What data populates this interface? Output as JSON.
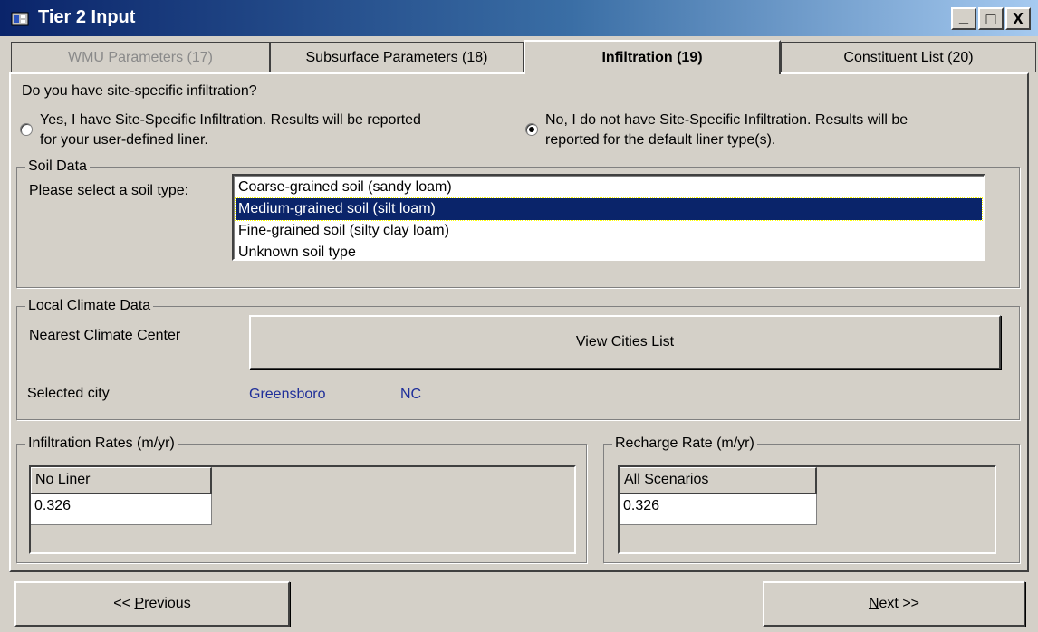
{
  "window": {
    "title": "Tier 2 Input",
    "minimize": "_",
    "maximize": "□",
    "close": "X"
  },
  "tabs": [
    {
      "label": "WMU Parameters (17)",
      "state": "disabled"
    },
    {
      "label": "Subsurface Parameters (18)",
      "state": "normal"
    },
    {
      "label": "Infiltration (19)",
      "state": "active"
    },
    {
      "label": "Constituent List (20)",
      "state": "normal"
    }
  ],
  "question": "Do you have site-specific infiltration?",
  "radios": {
    "yes": {
      "line1": "Yes, I have Site-Specific Infiltration.  Results will be reported",
      "line2": "for your user-defined liner.",
      "checked": false
    },
    "no": {
      "line1": "No, I do not have Site-Specific Infiltration.  Results will be",
      "line2": "reported for the default liner type(s).",
      "checked": true
    }
  },
  "soil": {
    "legend": "Soil Data",
    "prompt": "Please select a soil type:",
    "options": [
      "Coarse-grained soil (sandy loam)",
      "Medium-grained soil (silt loam)",
      "Fine-grained soil (silty clay loam)",
      "Unknown soil type"
    ],
    "selected_index": 1
  },
  "climate": {
    "legend": "Local Climate Data",
    "nearest_label": "Nearest Climate Center",
    "view_button": "View Cities List",
    "selected_label": "Selected city",
    "city": "Greensboro",
    "state": "NC",
    "value_color": "#1f2f9a"
  },
  "infiltration": {
    "legend": "Infiltration Rates (m/yr)",
    "column_header": "No Liner",
    "value": "0.326"
  },
  "recharge": {
    "legend": "Recharge Rate (m/yr)",
    "column_header": "All Scenarios",
    "value": "0.326"
  },
  "nav": {
    "previous_prefix": "<< ",
    "previous_mnemonic": "P",
    "previous_rest": "revious",
    "next_mnemonic": "N",
    "next_rest": "ext >>"
  },
  "colors": {
    "face": "#d4d0c8",
    "title_start": "#0a246a",
    "selection": "#0a246a"
  }
}
